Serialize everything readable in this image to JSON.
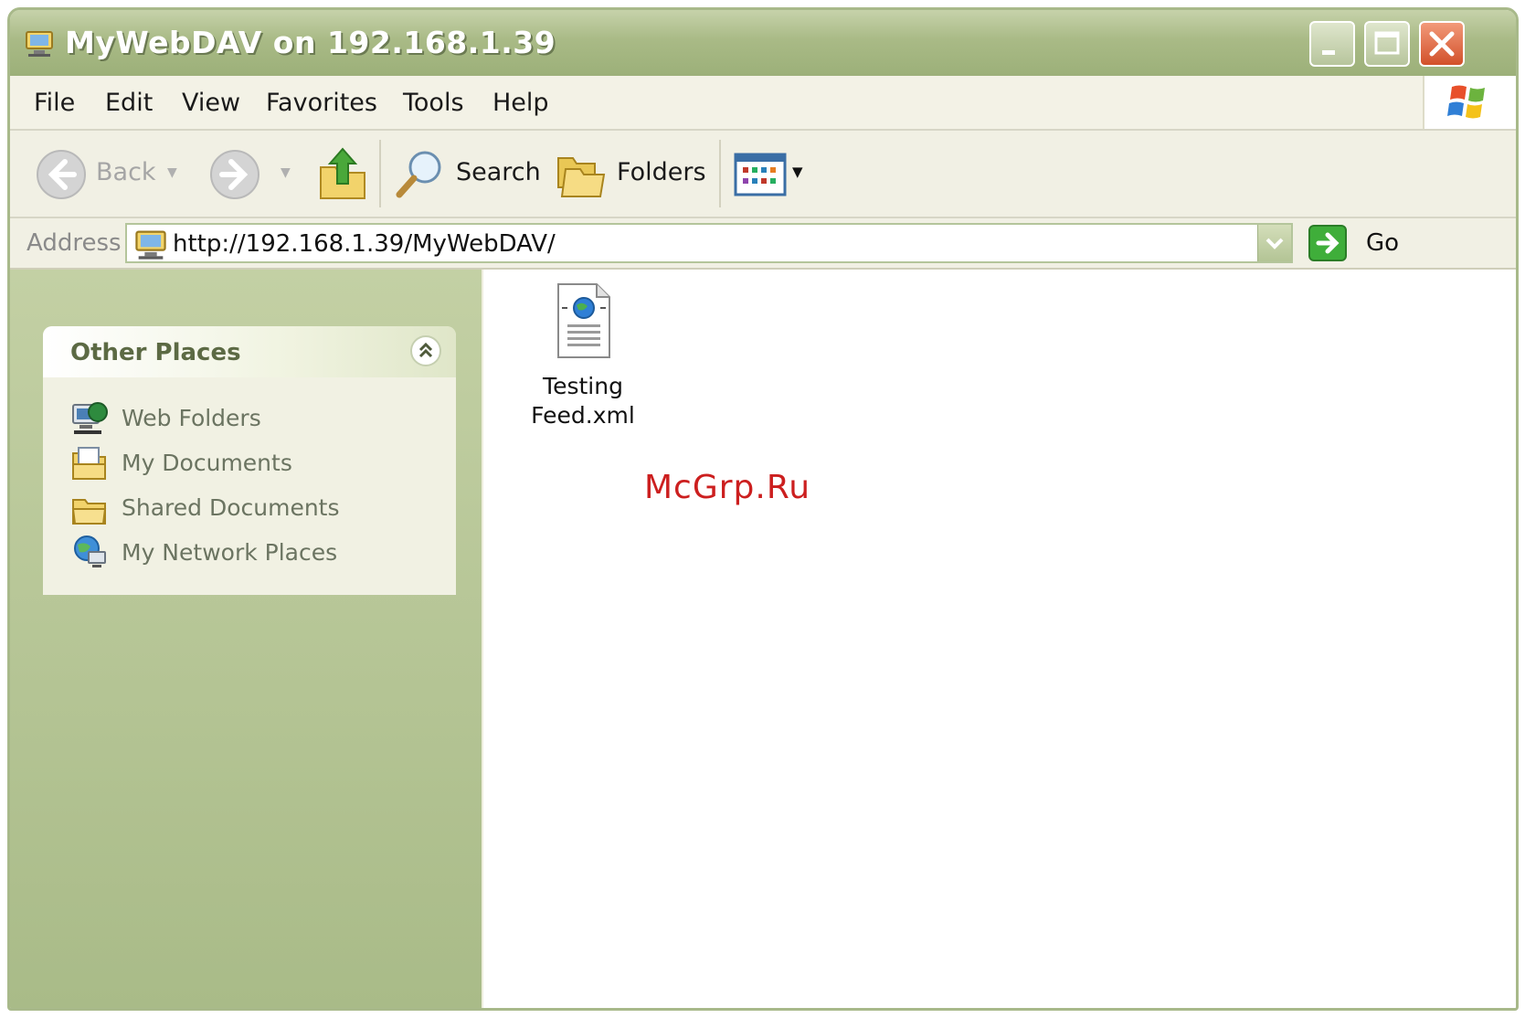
{
  "window": {
    "title": "MyWebDAV on 192.168.1.39"
  },
  "menu": {
    "items": [
      "File",
      "Edit",
      "View",
      "Favorites",
      "Tools",
      "Help"
    ]
  },
  "toolbar": {
    "back_label": "Back",
    "search_label": "Search",
    "folders_label": "Folders"
  },
  "address": {
    "label": "Address",
    "value": "http://192.168.1.39/MyWebDAV/",
    "go_label": "Go"
  },
  "sidebar": {
    "panel_title": "Other Places",
    "items": [
      {
        "label": "Web Folders",
        "icon": "web-folders-icon"
      },
      {
        "label": "My Documents",
        "icon": "my-documents-icon"
      },
      {
        "label": "Shared Documents",
        "icon": "shared-documents-icon"
      },
      {
        "label": "My Network Places",
        "icon": "network-places-icon"
      }
    ]
  },
  "files": [
    {
      "name_line1": "Testing",
      "name_line2": "Feed.xml",
      "icon": "xml-file-icon"
    }
  ],
  "watermark": "McGrp.Ru",
  "colors": {
    "title_bar": "#a9ba86",
    "left_pane": "#b6c696",
    "watermark": "#cc1f1f"
  }
}
